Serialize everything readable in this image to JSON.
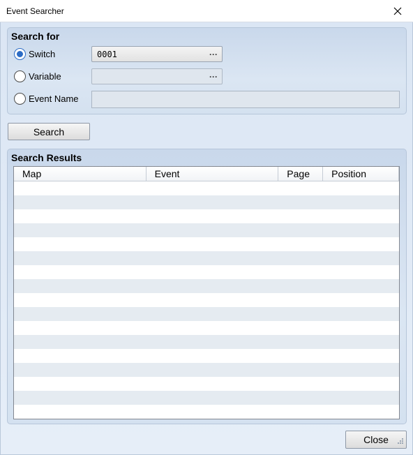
{
  "window": {
    "title": "Event Searcher",
    "close_icon": "close-icon"
  },
  "search_for": {
    "title": "Search for",
    "options": [
      {
        "label": "Switch",
        "checked": true,
        "value": "0001",
        "picker_button": "···"
      },
      {
        "label": "Variable",
        "checked": false,
        "value": "",
        "picker_button": "···"
      },
      {
        "label": "Event Name",
        "checked": false,
        "value": ""
      }
    ]
  },
  "search_button": "Search",
  "results": {
    "title": "Search Results",
    "columns": [
      "Map",
      "Event",
      "Page",
      "Position"
    ],
    "rows": []
  },
  "close_button": "Close",
  "colors": {
    "accent": "#2d6cc5",
    "row_alt": "#e5ebf1"
  }
}
